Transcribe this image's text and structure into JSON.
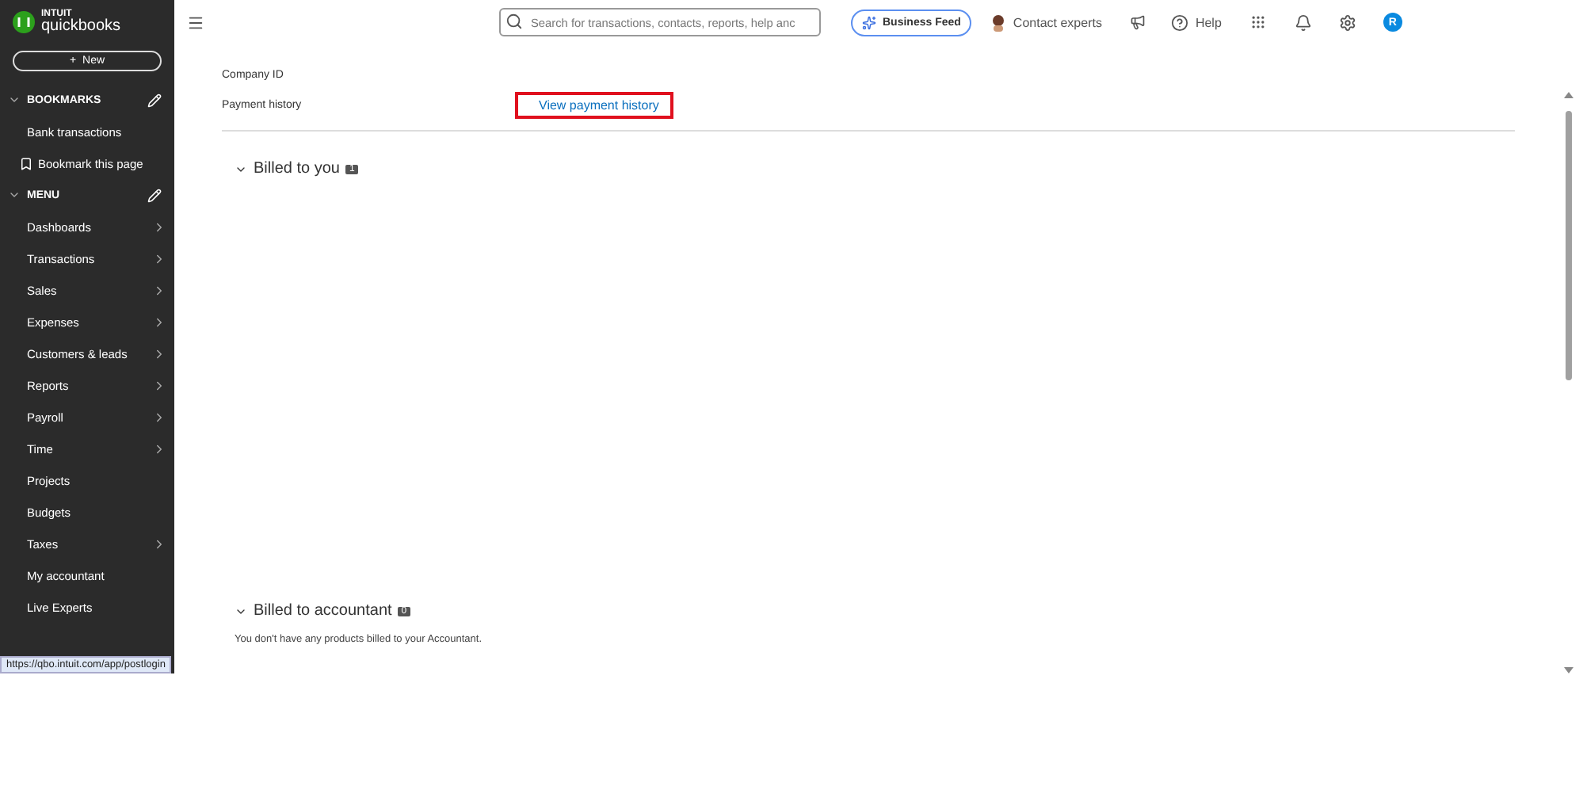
{
  "logo": {
    "brand": "INTUIT",
    "product": "quickbooks"
  },
  "new_button": {
    "label": "New",
    "icon": "+"
  },
  "sidebar": {
    "sections": [
      {
        "title": "BOOKMARKS",
        "expanded": true,
        "items": [
          {
            "label": "Bank transactions",
            "kind": "link",
            "has_submenu": false
          },
          {
            "label": "Bookmark this page",
            "kind": "bookmark",
            "has_submenu": false
          }
        ]
      },
      {
        "title": "MENU",
        "expanded": true,
        "items": [
          {
            "label": "Dashboards",
            "kind": "link",
            "has_submenu": true
          },
          {
            "label": "Transactions",
            "kind": "link",
            "has_submenu": true
          },
          {
            "label": "Sales",
            "kind": "link",
            "has_submenu": true
          },
          {
            "label": "Expenses",
            "kind": "link",
            "has_submenu": true
          },
          {
            "label": "Customers & leads",
            "kind": "link",
            "has_submenu": true
          },
          {
            "label": "Reports",
            "kind": "link",
            "has_submenu": true
          },
          {
            "label": "Payroll",
            "kind": "link",
            "has_submenu": true
          },
          {
            "label": "Time",
            "kind": "link",
            "has_submenu": true
          },
          {
            "label": "Projects",
            "kind": "link",
            "has_submenu": false
          },
          {
            "label": "Budgets",
            "kind": "link",
            "has_submenu": false
          },
          {
            "label": "Taxes",
            "kind": "link",
            "has_submenu": true
          },
          {
            "label": "My accountant",
            "kind": "link",
            "has_submenu": false
          },
          {
            "label": "Live Experts",
            "kind": "link",
            "has_submenu": false
          }
        ]
      }
    ]
  },
  "header": {
    "search": {
      "placeholder": "Search for transactions, contacts, reports, help anc"
    },
    "business_feed": "Business Feed",
    "contact_experts": "Contact experts",
    "help": "Help",
    "avatar": "R"
  },
  "details": [
    {
      "label": "Company ID"
    },
    {
      "label": "Payment history",
      "link": "View payment history",
      "highlighted": true
    }
  ],
  "sections": [
    {
      "title": "Billed to you",
      "count": "1",
      "expanded": true
    },
    {
      "title": "Billed to accountant",
      "count": "0",
      "expanded": true,
      "message": "You don't have any products billed to your Accountant."
    }
  ],
  "status_url": "https://qbo.intuit.com/app/postlogin"
}
